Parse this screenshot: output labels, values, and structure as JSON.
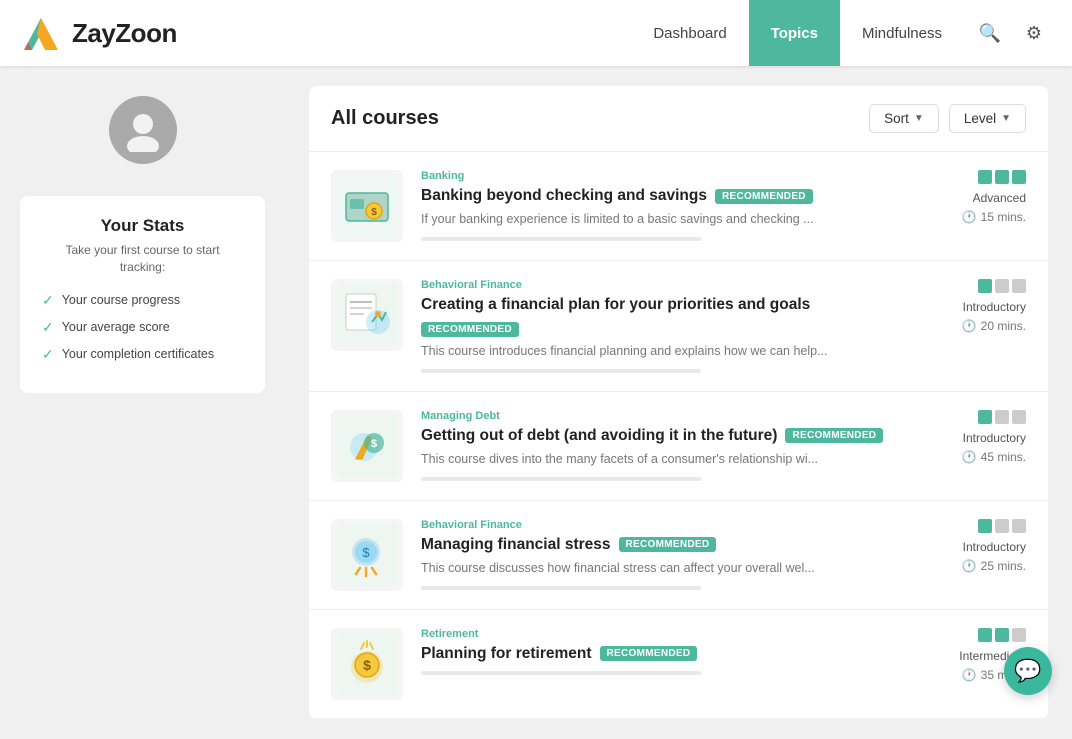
{
  "header": {
    "logo_text": "ZayZoon",
    "nav_items": [
      {
        "label": "Dashboard",
        "active": false
      },
      {
        "label": "Topics",
        "active": true
      },
      {
        "label": "Mindfulness",
        "active": false
      }
    ],
    "search_aria": "search",
    "settings_aria": "settings"
  },
  "sidebar": {
    "stats_title": "Your Stats",
    "stats_subtitle": "Take your first course to start tracking:",
    "stat_items": [
      {
        "label": "Your course progress"
      },
      {
        "label": "Your average score"
      },
      {
        "label": "Your completion certificates"
      }
    ]
  },
  "main": {
    "page_title": "All courses",
    "sort_label": "Sort",
    "level_label": "Level",
    "courses": [
      {
        "id": 1,
        "category": "Banking",
        "title": "Banking beyond checking and savings",
        "badge": "RECOMMENDED",
        "description": "If your banking experience is limited to a basic savings and checking ...",
        "level": "Advanced",
        "dots_filled": 3,
        "dots_total": 3,
        "time": "15 mins.",
        "progress": 0,
        "thumbnail_type": "banking"
      },
      {
        "id": 2,
        "category": "Behavioral Finance",
        "title": "Creating a financial plan for your priorities and goals",
        "badge": "RECOMMENDED",
        "description": "This course introduces financial planning and explains how we can help...",
        "level": "Introductory",
        "dots_filled": 1,
        "dots_total": 3,
        "time": "20 mins.",
        "progress": 0,
        "thumbnail_type": "financial-plan"
      },
      {
        "id": 3,
        "category": "Managing Debt",
        "title": "Getting out of debt (and avoiding it in the future)",
        "badge": "RECOMMENDED",
        "description": "This course dives into the many facets of a consumer's relationship wi...",
        "level": "Introductory",
        "dots_filled": 1,
        "dots_total": 3,
        "time": "45 mins.",
        "progress": 0,
        "thumbnail_type": "debt"
      },
      {
        "id": 4,
        "category": "Behavioral Finance",
        "title": "Managing financial stress",
        "badge": "RECOMMENDED",
        "description": "This course discusses how financial stress can affect your overall wel...",
        "level": "Introductory",
        "dots_filled": 1,
        "dots_total": 3,
        "time": "25 mins.",
        "progress": 0,
        "thumbnail_type": "stress"
      },
      {
        "id": 5,
        "category": "Retirement",
        "title": "Planning for retirement",
        "badge": "RECOMMENDED",
        "description": "",
        "level": "Intermediate",
        "dots_filled": 2,
        "dots_total": 3,
        "time": "35 mins.",
        "progress": 0,
        "thumbnail_type": "retirement"
      }
    ]
  }
}
